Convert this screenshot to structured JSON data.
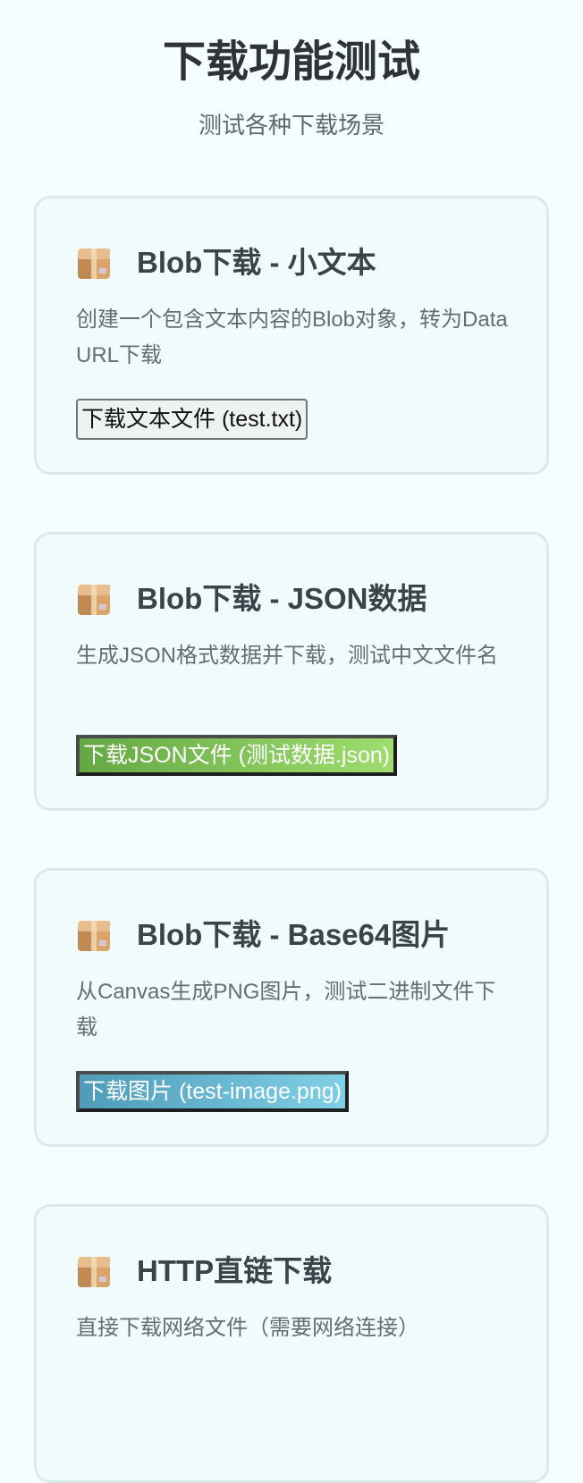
{
  "header": {
    "title": "下载功能测试",
    "subtitle": "测试各种下载场景"
  },
  "cards": [
    {
      "icon": "package-icon",
      "title": "Blob下载 - 小文本",
      "description": "创建一个包含文本内容的Blob对象，转为Data URL下载",
      "button": "下载文本文件 (test.txt)"
    },
    {
      "icon": "package-icon",
      "title": "Blob下载 - JSON数据",
      "description": "生成JSON格式数据并下载，测试中文文件名",
      "button": "下载JSON文件 (测试数据.json)"
    },
    {
      "icon": "package-icon",
      "title": "Blob下载 - Base64图片",
      "description": "从Canvas生成PNG图片，测试二进制文件下载",
      "button": "下载图片 (test-image.png)"
    },
    {
      "icon": "package-icon",
      "title": "HTTP直链下载",
      "description": "直接下载网络文件（需要网络连接）"
    }
  ]
}
